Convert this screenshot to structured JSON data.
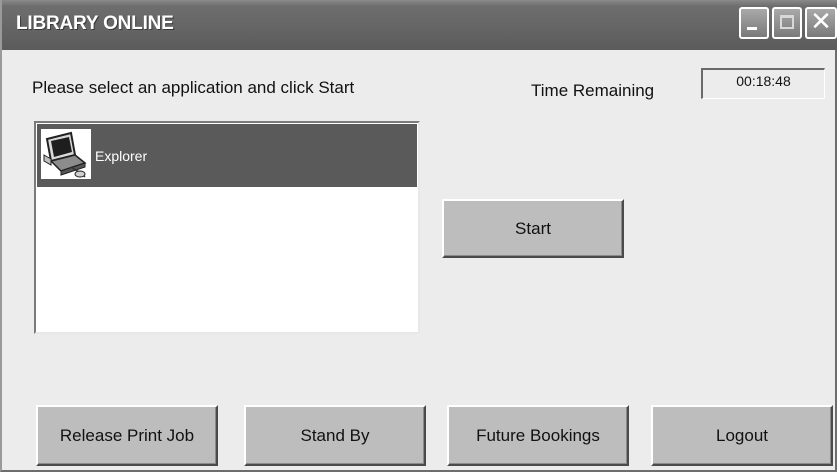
{
  "window": {
    "title": "LIBRARY ONLINE",
    "controls": {
      "minimize_icon": "minimize-icon",
      "maximize_icon": "maximize-icon",
      "close_icon": "close-icon",
      "close_glyph": "✕"
    }
  },
  "main": {
    "prompt": "Please select an application and click Start",
    "time_remaining_label": "Time Remaining",
    "time_remaining_value": "00:18:48"
  },
  "applications": {
    "items": [
      {
        "label": "Explorer",
        "icon": "computer-icon",
        "selected": true
      }
    ]
  },
  "buttons": {
    "start": "Start",
    "release_print_job": "Release Print Job",
    "stand_by": "Stand By",
    "future_bookings": "Future Bookings",
    "logout": "Logout"
  },
  "colors": {
    "titlebar": "#656565",
    "selection": "#5a5a5a",
    "button_face": "#bdbdbd",
    "window_bg": "#ececec"
  }
}
